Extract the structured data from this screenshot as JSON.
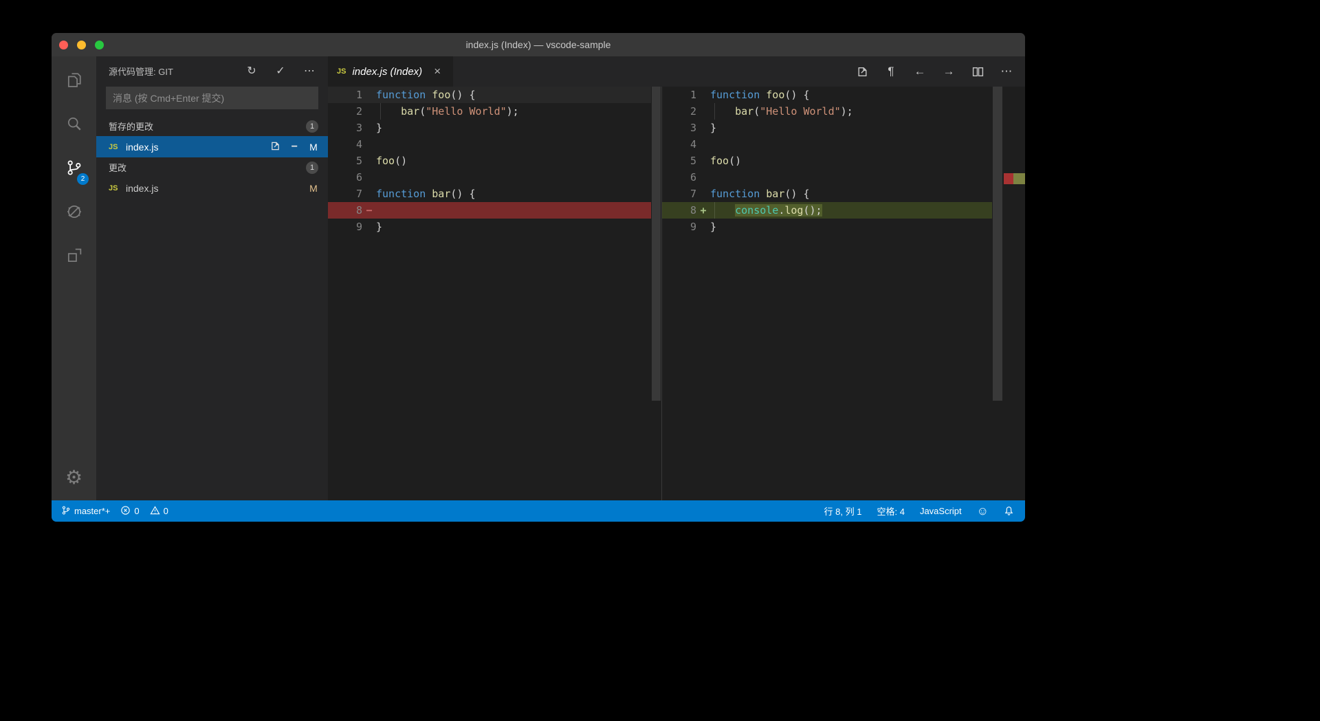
{
  "window": {
    "title": "index.js (Index) — vscode-sample"
  },
  "colors": {
    "statusbar": "#007acc",
    "selection": "#0e5a94",
    "removed_line": "#7a2a2a",
    "added_line": "#374020",
    "added_char": "#525f2c",
    "modified_badge": "#e2c08d",
    "keyword": "#569cd6",
    "function_name": "#dcdcaa",
    "string": "#ce9178",
    "builtin": "#4ec9b0"
  },
  "icons": {
    "refresh": "↻",
    "check": "✓",
    "more": "⋯",
    "unstage": "−",
    "pilcrow": "¶",
    "prev": "←",
    "next": "→",
    "gear": "⚙",
    "smiley": "☺",
    "close": "×"
  },
  "activity_bar": {
    "scm_badge": "2"
  },
  "sidebar": {
    "title": "源代码管理: GIT",
    "message_placeholder": "消息 (按 Cmd+Enter 提交)",
    "staged_section": {
      "label": "暂存的更改",
      "count": "1",
      "file": {
        "icon": "JS",
        "name": "index.js",
        "badge": "M"
      }
    },
    "changes_section": {
      "label": "更改",
      "count": "1",
      "file": {
        "icon": "JS",
        "name": "index.js",
        "badge": "M"
      }
    }
  },
  "editor": {
    "tab": {
      "icon": "JS",
      "label": "index.js (Index)"
    },
    "left": {
      "lines": [
        {
          "n": "1",
          "cls": "cur",
          "t": [
            [
              "k",
              "function"
            ],
            [
              "d",
              " "
            ],
            [
              "f",
              "foo"
            ],
            [
              "d",
              "() {"
            ]
          ]
        },
        {
          "n": "2",
          "g": 1,
          "t": [
            [
              "d",
              "    "
            ],
            [
              "f",
              "bar"
            ],
            [
              "d",
              "("
            ],
            [
              "s",
              "\"Hello World\""
            ],
            [
              "d",
              ");"
            ]
          ]
        },
        {
          "n": "3",
          "t": [
            [
              "d",
              "}"
            ]
          ]
        },
        {
          "n": "4",
          "t": []
        },
        {
          "n": "5",
          "t": [
            [
              "f",
              "foo"
            ],
            [
              "d",
              "()"
            ]
          ]
        },
        {
          "n": "6",
          "t": []
        },
        {
          "n": "7",
          "t": [
            [
              "k",
              "function"
            ],
            [
              "d",
              " "
            ],
            [
              "f",
              "bar"
            ],
            [
              "d",
              "() {"
            ]
          ]
        },
        {
          "n": "8",
          "m": "−",
          "cls": "removed",
          "t": []
        },
        {
          "n": "9",
          "t": [
            [
              "d",
              "}"
            ]
          ]
        }
      ]
    },
    "right": {
      "lines": [
        {
          "n": "1",
          "t": [
            [
              "k",
              "function"
            ],
            [
              "d",
              " "
            ],
            [
              "f",
              "foo"
            ],
            [
              "d",
              "() {"
            ]
          ]
        },
        {
          "n": "2",
          "g": 1,
          "t": [
            [
              "d",
              "    "
            ],
            [
              "f",
              "bar"
            ],
            [
              "d",
              "("
            ],
            [
              "s",
              "\"Hello World\""
            ],
            [
              "d",
              ");"
            ]
          ]
        },
        {
          "n": "3",
          "t": [
            [
              "d",
              "}"
            ]
          ]
        },
        {
          "n": "4",
          "t": []
        },
        {
          "n": "5",
          "t": [
            [
              "f",
              "foo"
            ],
            [
              "d",
              "()"
            ]
          ]
        },
        {
          "n": "6",
          "t": []
        },
        {
          "n": "7",
          "t": [
            [
              "k",
              "function"
            ],
            [
              "d",
              " "
            ],
            [
              "f",
              "bar"
            ],
            [
              "d",
              "() {"
            ]
          ]
        },
        {
          "n": "8",
          "m": "+",
          "cls": "added",
          "g": 1,
          "t": [
            [
              "d",
              "    "
            ],
            [
              "t",
              "console",
              1
            ],
            [
              "d",
              ".",
              1
            ],
            [
              "f",
              "log",
              1
            ],
            [
              "d",
              "();",
              1
            ]
          ]
        },
        {
          "n": "9",
          "t": [
            [
              "d",
              "}"
            ]
          ]
        }
      ]
    }
  },
  "statusbar": {
    "branch": "master*+",
    "errors": "0",
    "warnings": "0",
    "cursor": "行 8, 列 1",
    "indent": "空格: 4",
    "language": "JavaScript"
  }
}
